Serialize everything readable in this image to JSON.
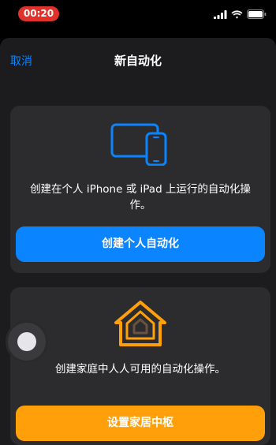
{
  "status_bar": {
    "time": "00:20",
    "icons": [
      "signal-bars-icon",
      "wifi-icon",
      "battery-icon"
    ],
    "time_pill_color": "#e0322b"
  },
  "nav": {
    "cancel_label": "取消",
    "title": "新自动化"
  },
  "personal_card": {
    "icon": "iphone-ipad-icon",
    "description": "创建在个人 iPhone 或 iPad 上运行的自动化操作。",
    "button_label": "创建个人自动化",
    "accent": "#0a84ff"
  },
  "home_card": {
    "icon": "home-icon",
    "description": "创建家庭中人人可用的自动化操作。",
    "button_label": "设置家居中枢",
    "accent": "#ff9f0a"
  },
  "assistive_touch": {
    "icon": "assistive-touch-icon"
  }
}
